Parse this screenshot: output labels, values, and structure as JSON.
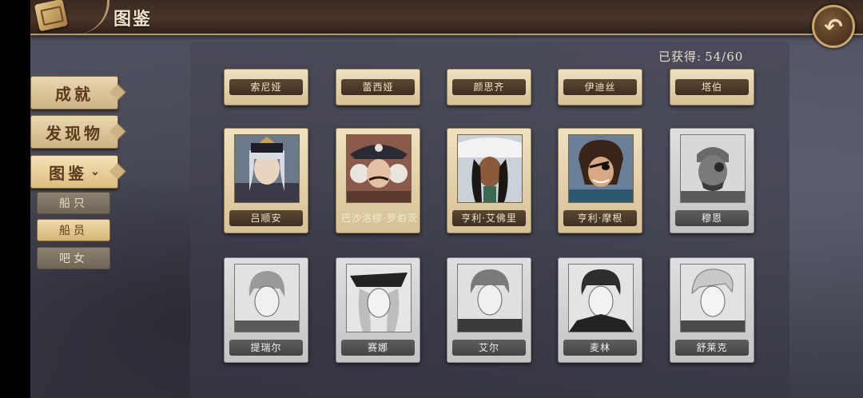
{
  "header": {
    "title": "图鉴",
    "back_icon": "back-arrow-icon"
  },
  "menu": {
    "achievements": "成就",
    "discoveries": "发现物",
    "codex": "图鉴",
    "codex_chevron": "⌄",
    "sub": {
      "ships": "船只",
      "crew": "船员",
      "barmaids": "吧女"
    }
  },
  "collection": {
    "label": "已获得:",
    "count": "54/60"
  },
  "top_row": [
    "索尼娅",
    "蕾西娅",
    "颜思齐",
    "伊迪丝",
    "塔伯"
  ],
  "row2": [
    {
      "name": "吕顺安",
      "unlocked": true
    },
    {
      "name": "巴沙洛缪·罗伯茨",
      "unlocked": true
    },
    {
      "name": "亨利·艾佛里",
      "unlocked": true
    },
    {
      "name": "亨利·摩根",
      "unlocked": true
    },
    {
      "name": "穆恩",
      "unlocked": false
    }
  ],
  "row3": [
    {
      "name": "提瑞尔",
      "unlocked": false
    },
    {
      "name": "赛娜",
      "unlocked": false
    },
    {
      "name": "艾尔",
      "unlocked": false
    },
    {
      "name": "麦林",
      "unlocked": false
    },
    {
      "name": "舒莱克",
      "unlocked": false
    }
  ],
  "colors": {
    "accent_gold": "#c9a66a",
    "panel": "#464655",
    "card_parchment": "#efe1c0"
  }
}
